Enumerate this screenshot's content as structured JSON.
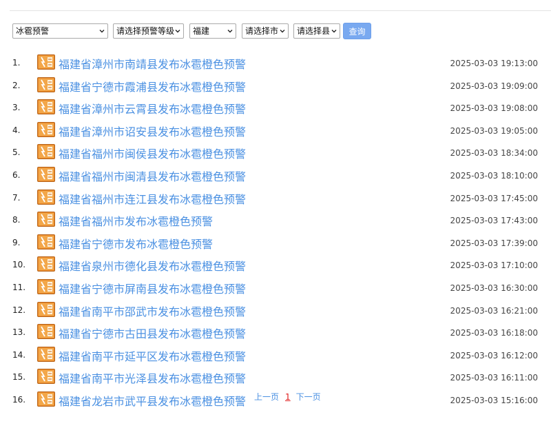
{
  "filters": {
    "type_value": "冰雹预警",
    "level_value": "请选择预警等级",
    "province_value": "福建",
    "city_value": "请选择市",
    "county_value": "请选择县",
    "query_label": "查询"
  },
  "icon": "orange-warning-icon",
  "colors": {
    "link": "#4a90e2",
    "button": "#79a9f0",
    "icon_bg": "#e8892b",
    "current_page": "#e01b1b"
  },
  "alerts": [
    {
      "index": "1.",
      "title": "福建省漳州市南靖县发布冰雹橙色预警",
      "time": "2025-03-03 19:13:00"
    },
    {
      "index": "2.",
      "title": "福建省宁德市霞浦县发布冰雹橙色预警",
      "time": "2025-03-03 19:09:00"
    },
    {
      "index": "3.",
      "title": "福建省漳州市云霄县发布冰雹橙色预警",
      "time": "2025-03-03 19:08:00"
    },
    {
      "index": "4.",
      "title": "福建省漳州市诏安县发布冰雹橙色预警",
      "time": "2025-03-03 19:05:00"
    },
    {
      "index": "5.",
      "title": "福建省福州市闽侯县发布冰雹橙色预警",
      "time": "2025-03-03 18:34:00"
    },
    {
      "index": "6.",
      "title": "福建省福州市闽清县发布冰雹橙色预警",
      "time": "2025-03-03 18:10:00"
    },
    {
      "index": "7.",
      "title": "福建省福州市连江县发布冰雹橙色预警",
      "time": "2025-03-03 17:45:00"
    },
    {
      "index": "8.",
      "title": "福建省福州市发布冰雹橙色预警",
      "time": "2025-03-03 17:43:00"
    },
    {
      "index": "9.",
      "title": "福建省宁德市发布冰雹橙色预警",
      "time": "2025-03-03 17:39:00"
    },
    {
      "index": "10.",
      "title": "福建省泉州市德化县发布冰雹橙色预警",
      "time": "2025-03-03 17:10:00"
    },
    {
      "index": "11.",
      "title": "福建省宁德市屏南县发布冰雹橙色预警",
      "time": "2025-03-03 16:30:00"
    },
    {
      "index": "12.",
      "title": "福建省南平市邵武市发布冰雹橙色预警",
      "time": "2025-03-03 16:21:00"
    },
    {
      "index": "13.",
      "title": "福建省宁德市古田县发布冰雹橙色预警",
      "time": "2025-03-03 16:18:00"
    },
    {
      "index": "14.",
      "title": "福建省南平市延平区发布冰雹橙色预警",
      "time": "2025-03-03 16:12:00"
    },
    {
      "index": "15.",
      "title": "福建省南平市光泽县发布冰雹橙色预警",
      "time": "2025-03-03 16:11:00"
    },
    {
      "index": "16.",
      "title": "福建省龙岩市武平县发布冰雹橙色预警",
      "time": "2025-03-03 15:16:00"
    }
  ],
  "pager": {
    "prev_label": "上一页",
    "current_page": "1",
    "next_label": "下一页"
  }
}
